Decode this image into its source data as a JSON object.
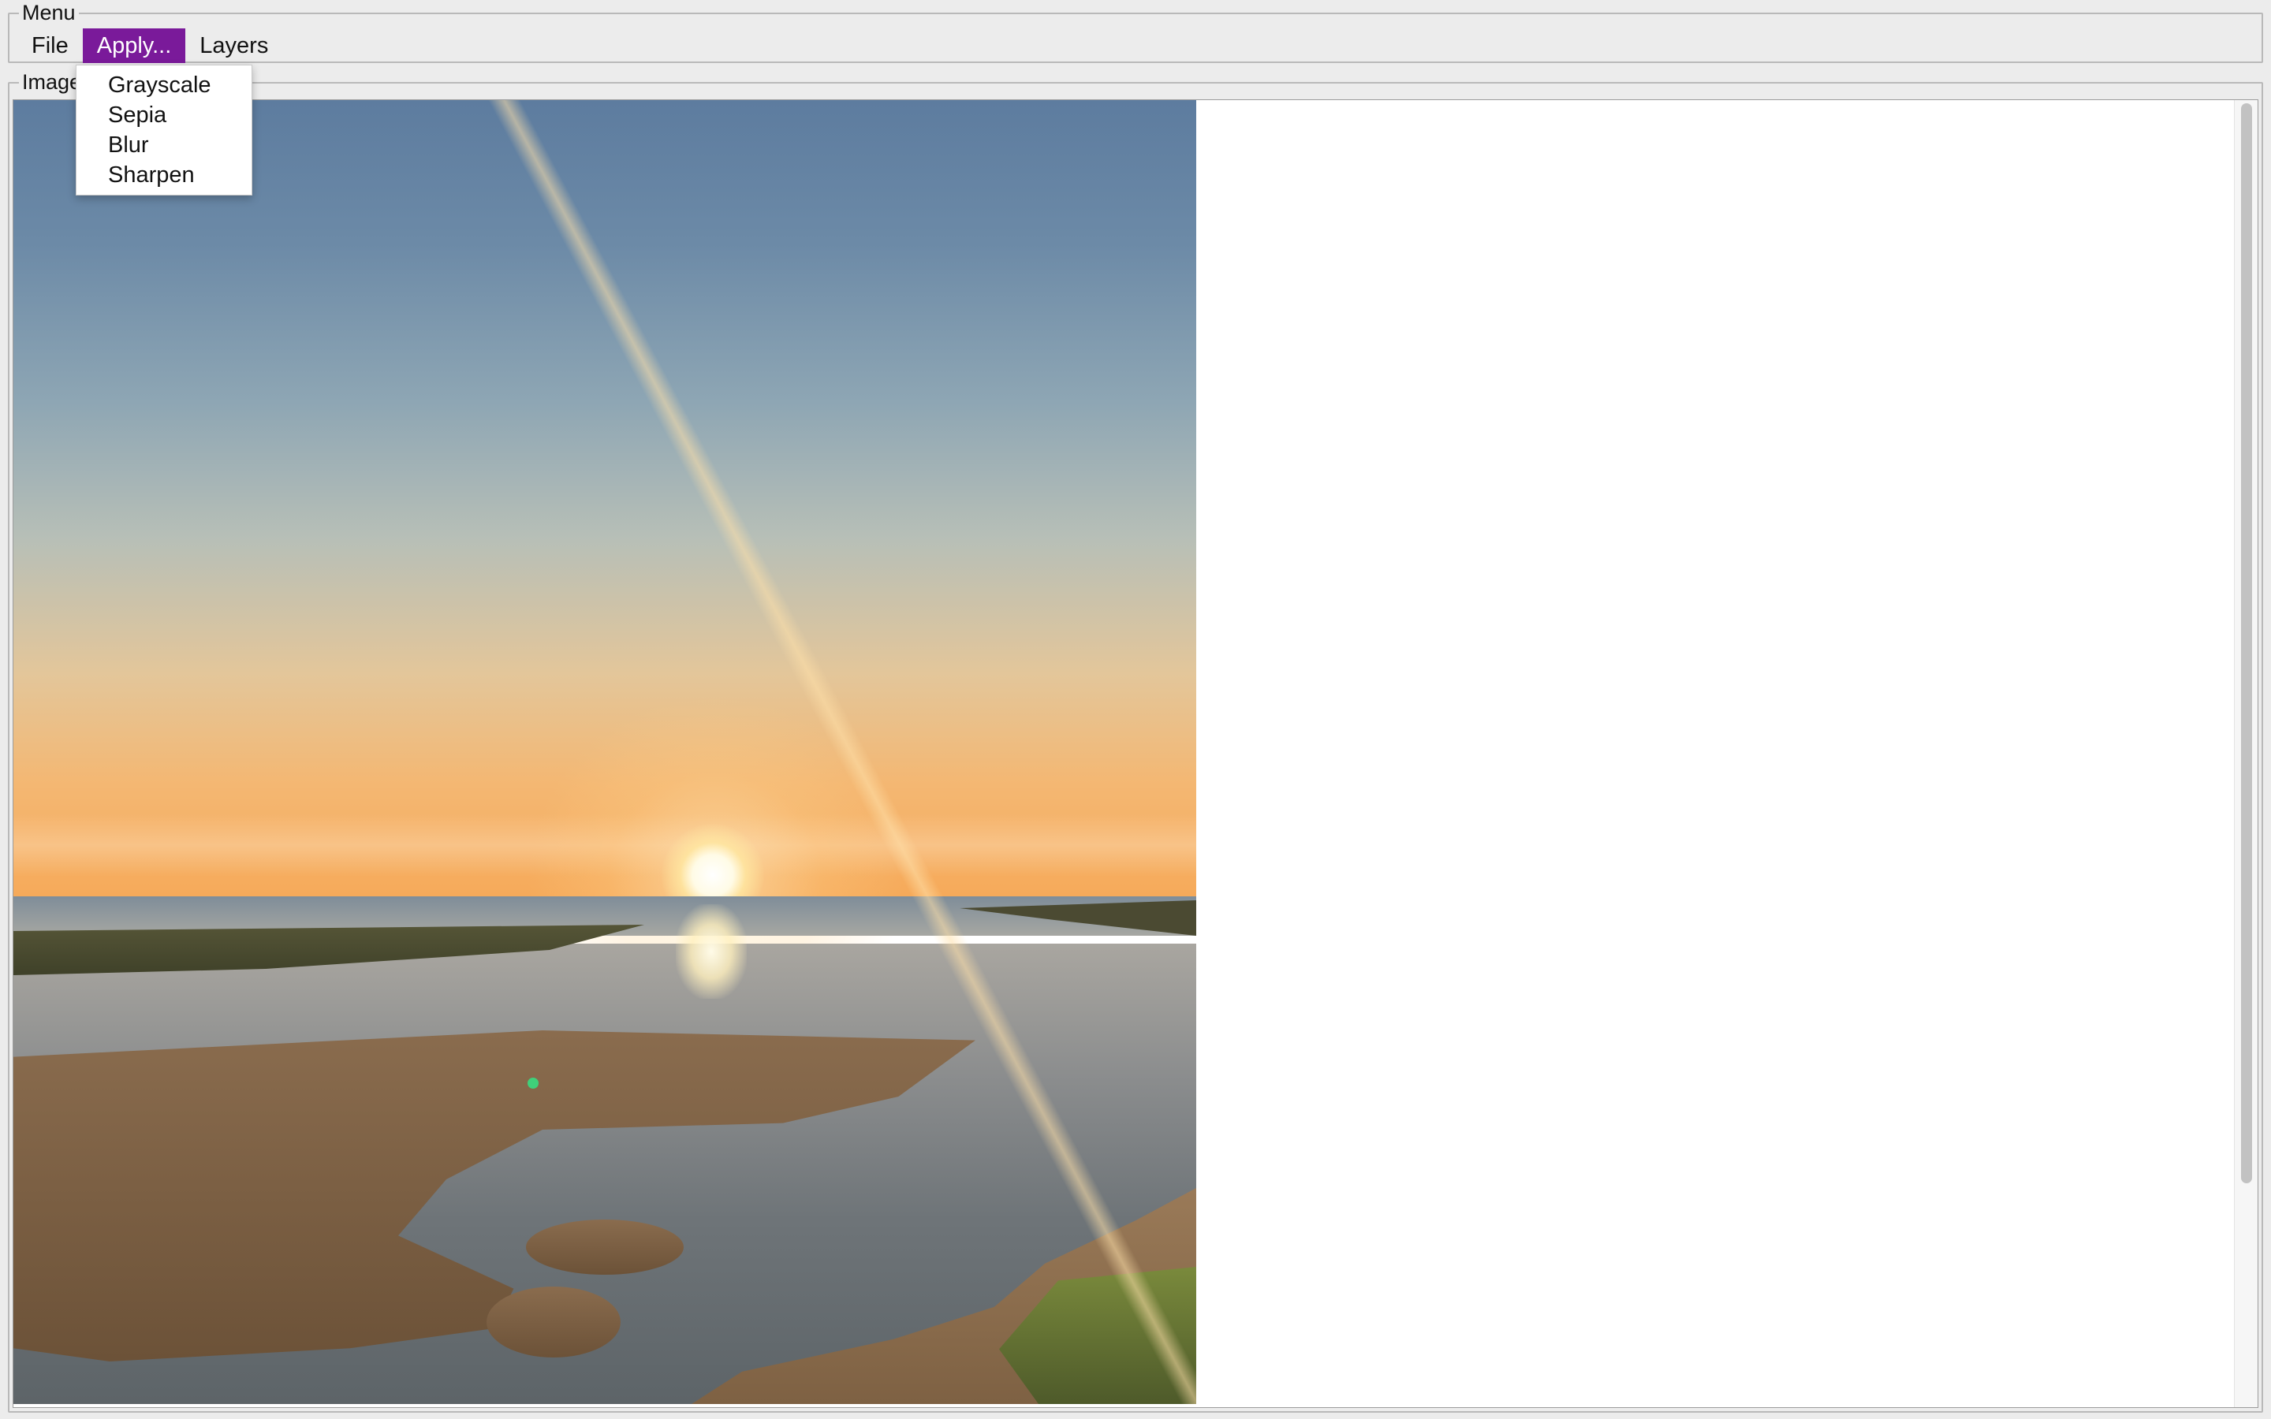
{
  "menu_group": {
    "title": "Menu"
  },
  "menu_bar": {
    "items": [
      {
        "label": "File",
        "active": false
      },
      {
        "label": "Apply...",
        "active": true
      },
      {
        "label": "Layers",
        "active": false
      }
    ]
  },
  "apply_menu": {
    "items": [
      "Grayscale",
      "Sepia",
      "Blur",
      "Sharpen"
    ]
  },
  "image_group": {
    "title": "Image"
  },
  "colors": {
    "menu_active_bg": "#7a1a9a",
    "menu_active_fg": "#ffffff",
    "window_bg": "#ececec",
    "canvas_bg": "#ffffff"
  },
  "photo": {
    "subject": "sunset over tidal flats and beach"
  },
  "scrollbar": {
    "orientation": "vertical"
  }
}
